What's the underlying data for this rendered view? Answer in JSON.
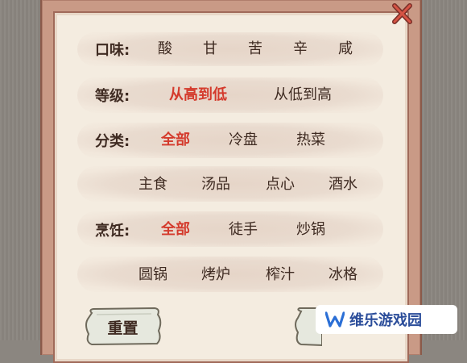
{
  "filters": {
    "taste": {
      "label": "口味:",
      "options": [
        "酸",
        "甘",
        "苦",
        "辛",
        "咸"
      ]
    },
    "level": {
      "label": "等级:",
      "options": [
        "从高到低",
        "从低到高"
      ],
      "selected": "从高到低"
    },
    "category": {
      "label": "分类:",
      "row1": [
        "全部",
        "冷盘",
        "热菜"
      ],
      "row2": [
        "主食",
        "汤品",
        "点心",
        "酒水"
      ],
      "selected": "全部"
    },
    "cooking": {
      "label": "烹饪:",
      "row1": [
        "全部",
        "徒手",
        "炒锅"
      ],
      "row2": [
        "圆锅",
        "烤炉",
        "榨汁",
        "冰格"
      ],
      "selected": "全部"
    }
  },
  "buttons": {
    "reset_label": "重置"
  },
  "watermark": {
    "text": "维乐游戏园"
  },
  "colors": {
    "selected": "#d43a2c",
    "text": "#3f2b22",
    "panel_border": "#c99a86",
    "panel_bg": "#f4ece0",
    "backdrop": "#8b8680"
  }
}
